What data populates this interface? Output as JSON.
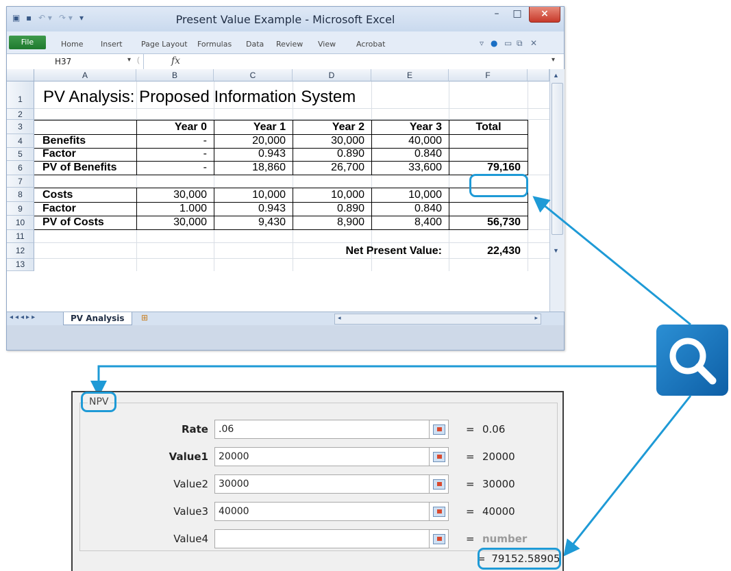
{
  "window": {
    "title": "Present Value Example - Microsoft Excel",
    "minimize": "–",
    "maximize": "□",
    "close": "×"
  },
  "ribbon": {
    "file": "File",
    "tabs": [
      "Home",
      "Insert",
      "Page Layout",
      "Formulas",
      "Data",
      "Review",
      "View",
      "Acrobat"
    ]
  },
  "formula_bar": {
    "name_box": "H37",
    "fx": "fx",
    "value": ""
  },
  "columns": [
    "A",
    "B",
    "C",
    "D",
    "E",
    "F"
  ],
  "rows": [
    "1",
    "2",
    "3",
    "4",
    "5",
    "6",
    "7",
    "8",
    "9",
    "10",
    "11",
    "12",
    "13"
  ],
  "sheet": {
    "title": "PV Analysis:  Proposed Information System",
    "headers": [
      "Year 0",
      "Year 1",
      "Year 2",
      "Year 3",
      "Total"
    ],
    "benefits": {
      "label": "Benefits",
      "values": [
        "-",
        "20,000",
        "30,000",
        "40,000",
        ""
      ]
    },
    "factor1": {
      "label": "Factor",
      "values": [
        "-",
        "0.943",
        "0.890",
        "0.840",
        ""
      ]
    },
    "pv_benefits": {
      "label": "PV of Benefits",
      "values": [
        "-",
        "18,860",
        "26,700",
        "33,600",
        "79,160"
      ]
    },
    "costs": {
      "label": "Costs",
      "values": [
        "30,000",
        "10,000",
        "10,000",
        "10,000",
        ""
      ]
    },
    "factor2": {
      "label": "Factor",
      "values": [
        "1.000",
        "0.943",
        "0.890",
        "0.840",
        ""
      ]
    },
    "pv_costs": {
      "label": "PV of Costs",
      "values": [
        "30,000",
        "9,430",
        "8,900",
        "8,400",
        "56,730"
      ]
    },
    "npv_label": "Net Present Value:",
    "npv_value": "22,430"
  },
  "sheet_tab": "PV Analysis",
  "npv_dialog": {
    "function_name": "NPV",
    "args": [
      {
        "label": "Rate",
        "input": ".06",
        "result": "0.06",
        "bold": true
      },
      {
        "label": "Value1",
        "input": "20000",
        "result": "20000",
        "bold": true
      },
      {
        "label": "Value2",
        "input": "30000",
        "result": "30000",
        "bold": false
      },
      {
        "label": "Value3",
        "input": "40000",
        "result": "40000",
        "bold": false
      },
      {
        "label": "Value4",
        "input": "",
        "result": "number",
        "bold": false
      }
    ],
    "equals": "=",
    "result": "79152.58905"
  },
  "colors": {
    "highlight": "#1e9ad6",
    "magnifier_bg": "#1473bd"
  }
}
